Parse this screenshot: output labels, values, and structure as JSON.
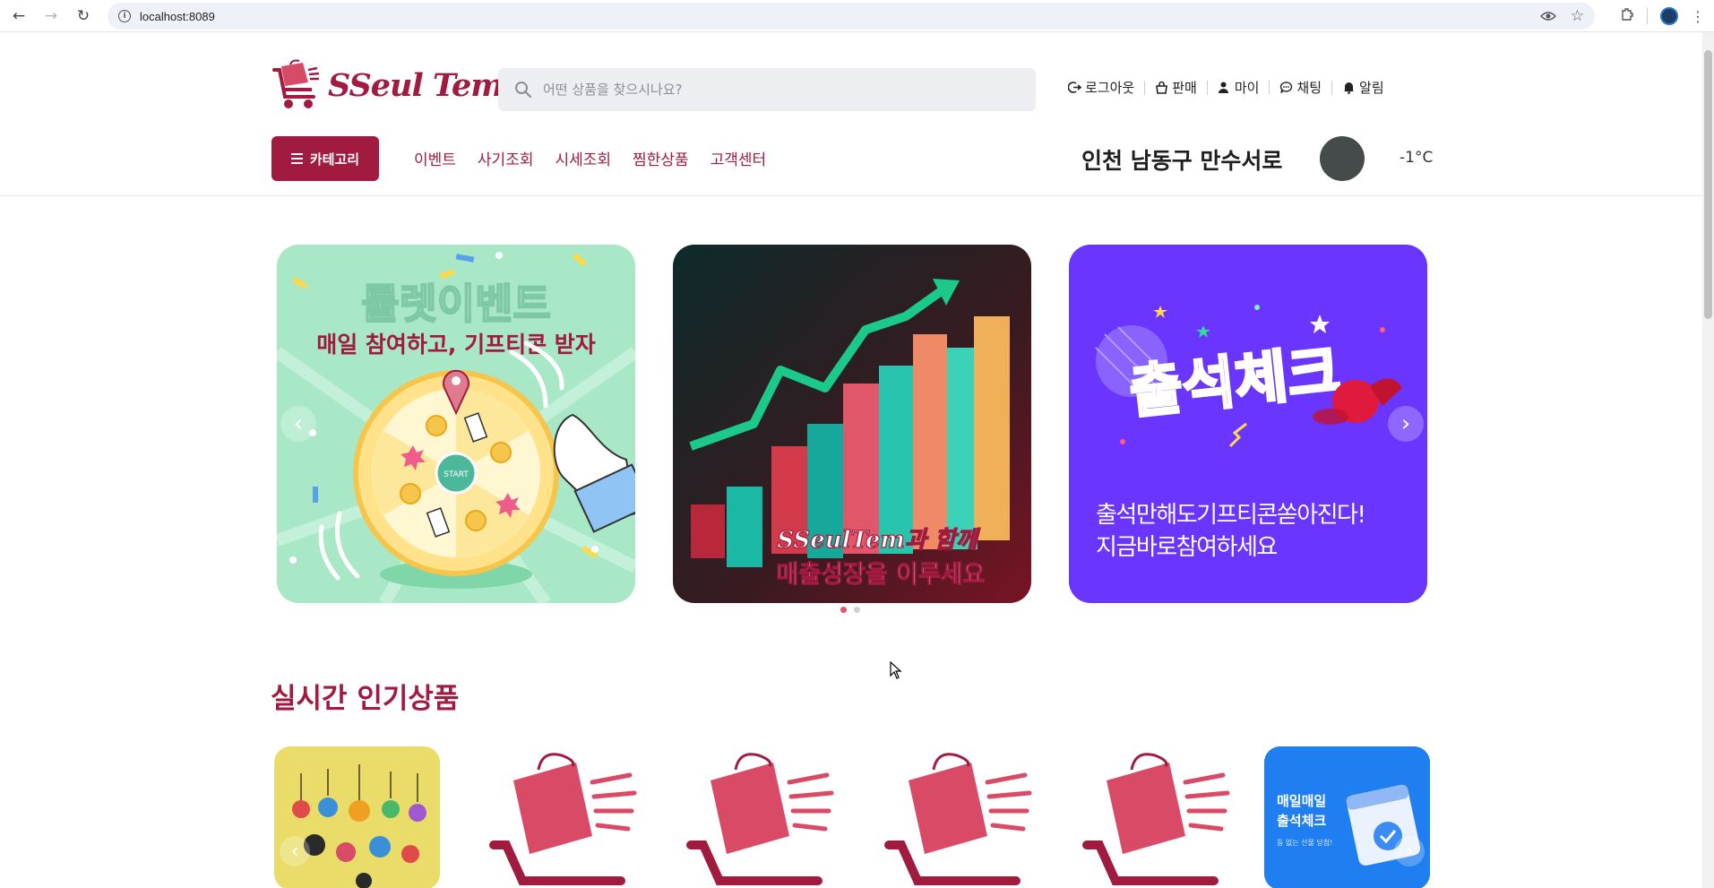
{
  "browser": {
    "url": "localhost:8089"
  },
  "header": {
    "logo_text": "SSeul Tem",
    "search_placeholder": "어떤 상품을 찾으시나요?",
    "top_links": [
      {
        "label": "로그아웃",
        "icon": "logout-icon"
      },
      {
        "label": "판매",
        "icon": "sell-icon"
      },
      {
        "label": "마이",
        "icon": "user-icon"
      },
      {
        "label": "채팅",
        "icon": "chat-icon"
      },
      {
        "label": "알림",
        "icon": "bell-icon"
      }
    ],
    "category_label": "카테고리",
    "menu": [
      "이벤트",
      "사기조회",
      "시세조회",
      "찜한상품",
      "고객센터"
    ],
    "location": "인천 남동구 만수서로",
    "temperature": "-1°C"
  },
  "banners": [
    {
      "title": "룰렛이벤트",
      "subtitle": "매일 참여하고, 기프티콘 받자",
      "wheel_label": "START",
      "bg": "#a8e8c6"
    },
    {
      "line1": "SSeulTem과 함께",
      "line2": "매출성장을 이루세요",
      "bg": "#2a1f22"
    },
    {
      "title": "출석체크",
      "line1": "출석만해도기프티콘쏟아진다!",
      "line2": "지금바로참여하세요",
      "bg": "#6a35ff"
    }
  ],
  "carousel": {
    "dots": 2,
    "active_dot": 0
  },
  "popular": {
    "title": "실시간 인기상품",
    "last_card_text": [
      "매일매일",
      "출석체크"
    ],
    "last_card_sub": "동 없는 선물 당첨!"
  },
  "colors": {
    "brand": "#a01b3f",
    "brand_light": "#d94a66"
  }
}
